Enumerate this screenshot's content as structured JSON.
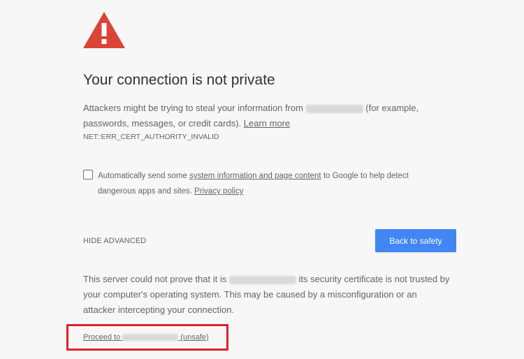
{
  "interstitial": {
    "title": "Your connection is not private",
    "intro_before": "Attackers might be trying to steal your information from",
    "intro_after": "(for example, passwords, messages, or credit cards).",
    "learn_more": "Learn more",
    "error_code": "NET::ERR_CERT_AUTHORITY_INVALID",
    "report": {
      "prefix": "Automatically send some",
      "link": "system information and page content",
      "suffix": "to Google to help detect dangerous apps and sites.",
      "privacy_link": "Privacy policy",
      "checked": false
    },
    "hide_advanced": "HIDE ADVANCED",
    "back_button": "Back to safety",
    "details_before": "This server could not prove that it is",
    "details_after": "its security certificate is not trusted by your computer's operating system. This may be caused by a misconfiguration or an attacker intercepting your connection.",
    "proceed_prefix": "Proceed to",
    "proceed_suffix": "(unsafe)"
  },
  "colors": {
    "background": "#f7f7f7",
    "warning_red": "#db4437",
    "button_blue": "#4285f4",
    "highlight_box": "#e0202b"
  },
  "icons": {
    "warning": "warning-triangle-icon",
    "checkbox": "checkbox-unchecked"
  }
}
